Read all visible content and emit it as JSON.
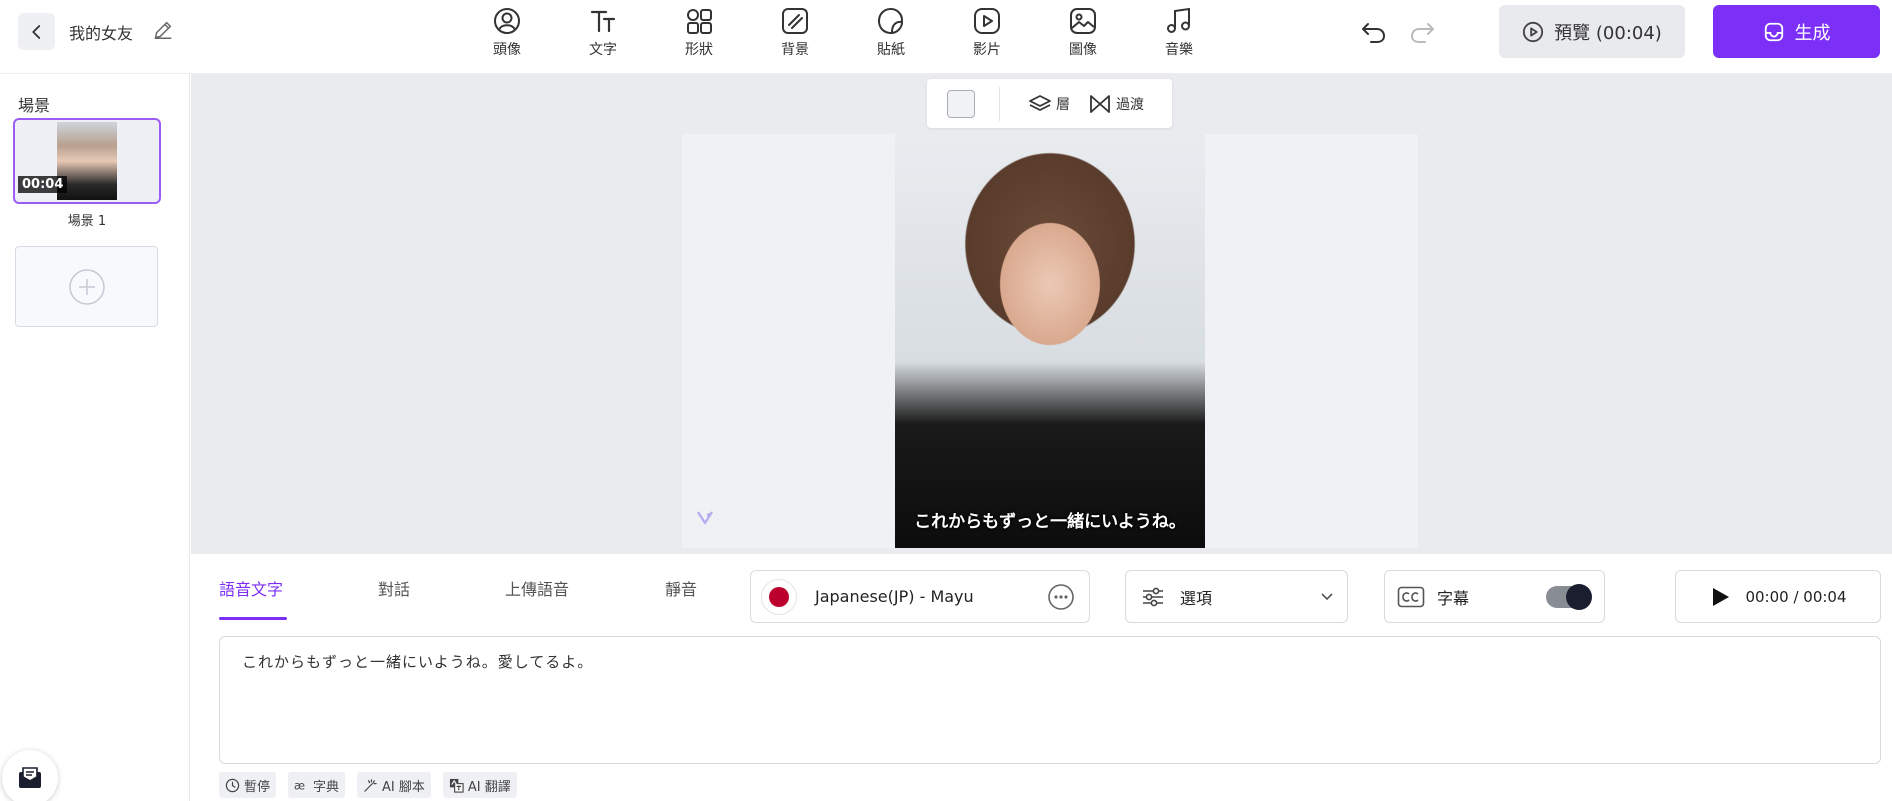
{
  "header": {
    "project_title": "我的女友",
    "tools": [
      {
        "label": "頭像",
        "icon": "avatar-icon"
      },
      {
        "label": "文字",
        "icon": "text-icon"
      },
      {
        "label": "形狀",
        "icon": "shapes-icon"
      },
      {
        "label": "背景",
        "icon": "background-icon"
      },
      {
        "label": "貼紙",
        "icon": "sticker-icon"
      },
      {
        "label": "影片",
        "icon": "video-icon"
      },
      {
        "label": "圖像",
        "icon": "image-icon"
      },
      {
        "label": "音樂",
        "icon": "music-icon"
      }
    ],
    "preview_label": "預覽 (00:04)",
    "generate_label": "生成",
    "accent_color": "#7b2ff7"
  },
  "sidebar": {
    "heading": "場景",
    "scenes": [
      {
        "label": "場景 1",
        "duration": "00:04"
      }
    ]
  },
  "canvas": {
    "toolbar": {
      "layer_label": "層",
      "transition_label": "過渡"
    },
    "subtitle_text": "これからもずっと一緒にいようね。"
  },
  "panel": {
    "tabs": [
      {
        "label": "語音文字",
        "active": true
      },
      {
        "label": "對話",
        "active": false
      },
      {
        "label": "上傳語音",
        "active": false
      },
      {
        "label": "靜音",
        "active": false
      }
    ],
    "voice": "Japanese(JP) - Mayu",
    "options_label": "選項",
    "subtitles_label": "字幕",
    "subtitles_enabled": true,
    "time_readout": "00:00 / 00:04",
    "script_text": "これからもずっと一緒にいようね。愛してるよ。",
    "chips": [
      {
        "label": "暫停",
        "icon": "clock-icon"
      },
      {
        "label": "字典",
        "icon": "dictionary-icon"
      },
      {
        "label": "AI 腳本",
        "icon": "magic-wand-icon"
      },
      {
        "label": "AI 翻譯",
        "icon": "translate-icon"
      }
    ]
  }
}
